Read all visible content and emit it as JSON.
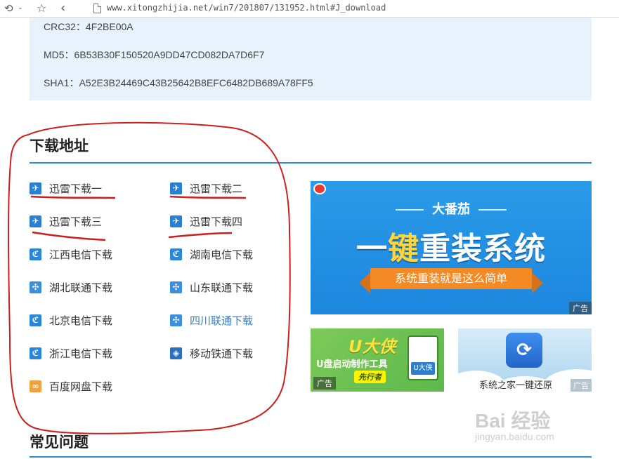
{
  "browser": {
    "url": "www.xitongzhijia.net/win7/201807/131952.html#J_download"
  },
  "hashes": [
    "CRC32：4F2BE00A",
    "MD5：6B53B30F150520A9DD47CD082DA7D6F7",
    "SHA1：A52E3B24469C43B25642B8EFC6482DB689A78FF5"
  ],
  "download": {
    "title": "下载地址",
    "links": [
      {
        "label": "迅雷下载一",
        "icon": "thunder-icon"
      },
      {
        "label": "迅雷下载二",
        "icon": "thunder-icon"
      },
      {
        "label": "迅雷下载三",
        "icon": "thunder-icon"
      },
      {
        "label": "迅雷下载四",
        "icon": "thunder-icon"
      },
      {
        "label": "江西电信下载",
        "icon": "telecom-icon"
      },
      {
        "label": "湖南电信下载",
        "icon": "telecom-icon"
      },
      {
        "label": "湖北联通下载",
        "icon": "unicom-icon"
      },
      {
        "label": "山东联通下载",
        "icon": "unicom-icon"
      },
      {
        "label": "北京电信下载",
        "icon": "telecom-icon"
      },
      {
        "label": "四川联通下载",
        "icon": "unicom-icon"
      },
      {
        "label": "浙江电信下载",
        "icon": "telecom-icon"
      },
      {
        "label": "移动铁通下载",
        "icon": "mobile-icon"
      },
      {
        "label": "百度网盘下载",
        "icon": "baidu-pan-icon"
      }
    ]
  },
  "ads": {
    "main": {
      "subtitle": "大番茄",
      "headline_a": "一",
      "headline_b": "键",
      "headline_c": "重装系统",
      "ribbon": "系统重装就是这么简单",
      "tag": "广告"
    },
    "udax": {
      "title": "U大侠",
      "subtitle": "U盘启动制作工具",
      "badge": "先行者",
      "usb_label": "U大侠",
      "tag": "广告"
    },
    "restore": {
      "text": "系统之家一键还原",
      "tag": "广告"
    }
  },
  "faq": {
    "title": "常见问题"
  },
  "watermark": {
    "text": "Bai  经验",
    "sub": "jingyan.baidu.com"
  },
  "colors": {
    "accent": "#2a8fd3",
    "hash_bg": "#e8f2fd",
    "annotation": "#cc1f1f"
  }
}
